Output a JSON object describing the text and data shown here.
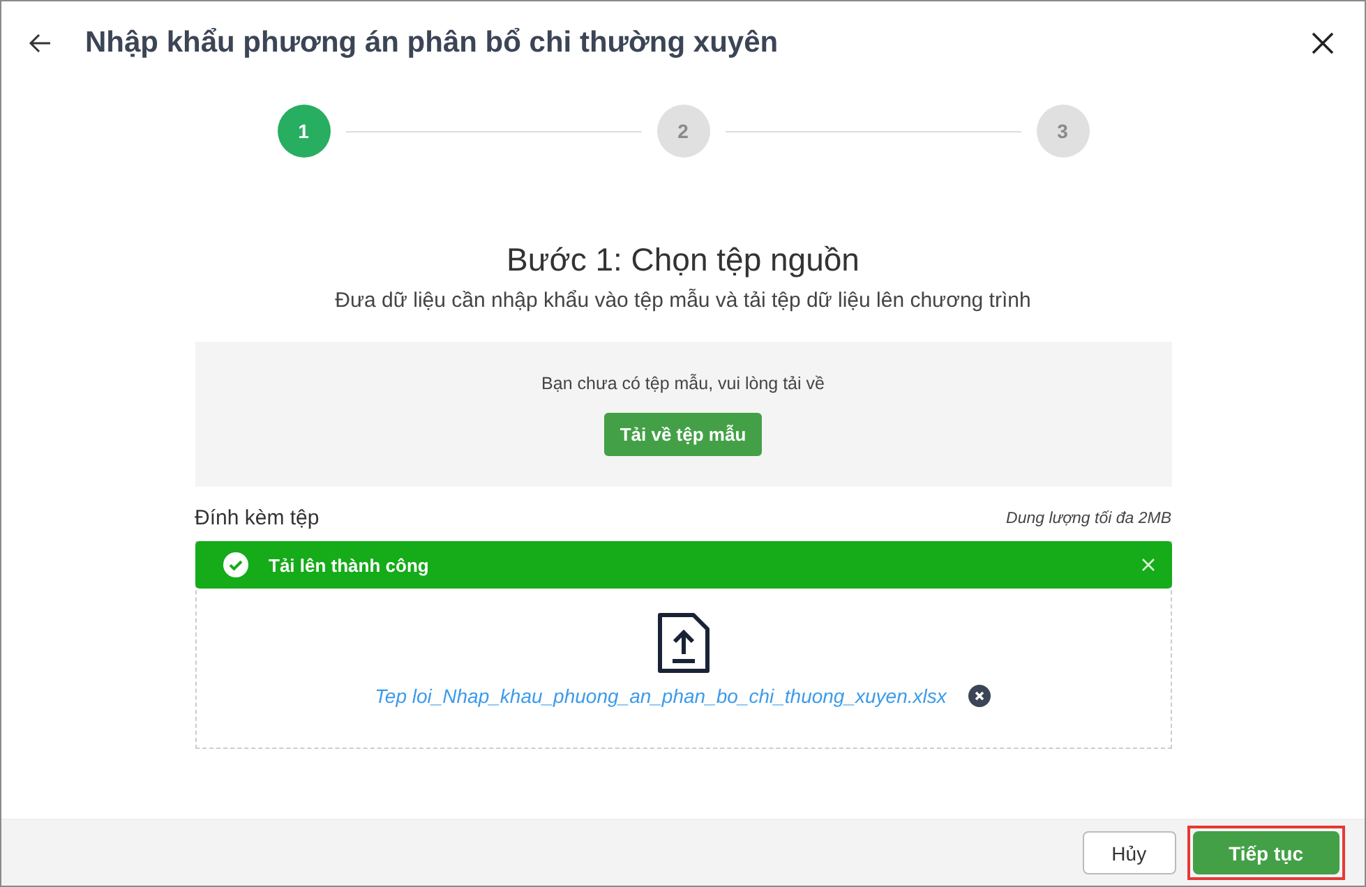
{
  "dialog": {
    "title": "Nhập khẩu phương án phân bổ chi thường xuyên"
  },
  "steps": [
    {
      "label": "1",
      "active": true
    },
    {
      "label": "2",
      "active": false
    },
    {
      "label": "3",
      "active": false
    }
  ],
  "heading": "Bước 1: Chọn tệp nguồn",
  "subheading": "Đưa dữ liệu cần nhập khẩu vào tệp mẫu và tải tệp dữ liệu lên chương trình",
  "template_panel": {
    "message": "Bạn chưa có tệp mẫu, vui lòng tải về",
    "button": "Tải về tệp mẫu"
  },
  "attachment": {
    "label": "Đính kèm tệp",
    "limit": "Dung lượng tối đa 2MB",
    "alert": "Tải lên thành công",
    "file_name": "Tep loi_Nhap_khau_phuong_an_phan_bo_chi_thuong_xuyen.xlsx"
  },
  "footer": {
    "buttons": [
      {
        "label": "Hủy",
        "kind": "secondary",
        "highlighted": false
      },
      {
        "label": "Tiếp tục",
        "kind": "primary",
        "highlighted": true
      }
    ]
  }
}
